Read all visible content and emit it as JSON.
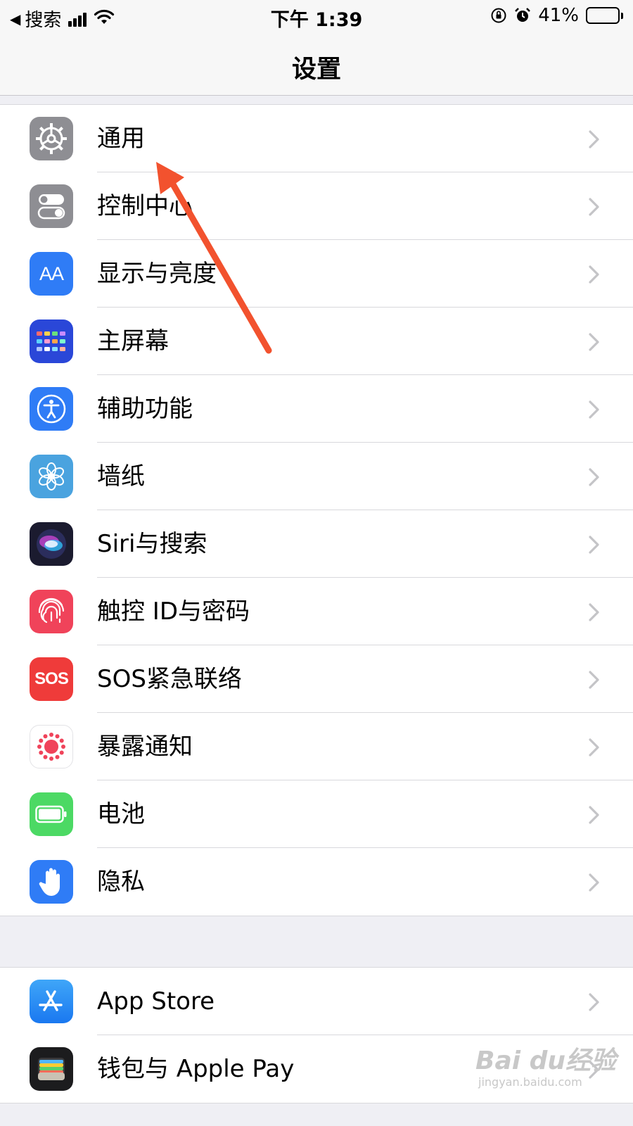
{
  "status_bar": {
    "back_label": "搜索",
    "time": "下午 1:39",
    "battery_percent": "41%",
    "battery_level": 0.41
  },
  "nav": {
    "title": "设置"
  },
  "group1": [
    {
      "label": "通用",
      "icon": "gear-icon",
      "color": "#8e8e93"
    },
    {
      "label": "控制中心",
      "icon": "toggles-icon",
      "color": "#8e8e93"
    },
    {
      "label": "显示与亮度",
      "icon": "display-aa-icon",
      "icon_text": "AA",
      "color": "#2f7cf6"
    },
    {
      "label": "主屏幕",
      "icon": "home-screen-icon",
      "color": "#2a47d8"
    },
    {
      "label": "辅助功能",
      "icon": "accessibility-icon",
      "color": "#2f7cf6"
    },
    {
      "label": "墙纸",
      "icon": "wallpaper-flower-icon",
      "color": "#4aa3df"
    },
    {
      "label": "Siri与搜索",
      "icon": "siri-icon",
      "color": "#1b1b2f"
    },
    {
      "label": "触控 ID与密码",
      "icon": "fingerprint-icon",
      "color": "#f0435a"
    },
    {
      "label": "SOS紧急联络",
      "icon": "sos-icon",
      "icon_text": "SOS",
      "color": "#ef3b3a"
    },
    {
      "label": "暴露通知",
      "icon": "exposure-notification-icon",
      "color": "#ffffff"
    },
    {
      "label": "电池",
      "icon": "battery-icon",
      "color": "#4cd964"
    },
    {
      "label": "隐私",
      "icon": "hand-icon",
      "color": "#2f7cf6"
    }
  ],
  "group2": [
    {
      "label": "App Store",
      "icon": "app-store-icon",
      "color": "#2f8ff6"
    },
    {
      "label": "钱包与 Apple Pay",
      "icon": "wallet-icon",
      "color": "#1c1c1e"
    }
  ],
  "watermark": {
    "brand": "Bai du经验",
    "url": "jingyan.baidu.com"
  },
  "colors": {
    "annotation_arrow": "#f2522e",
    "chevron": "#c4c4c7"
  }
}
